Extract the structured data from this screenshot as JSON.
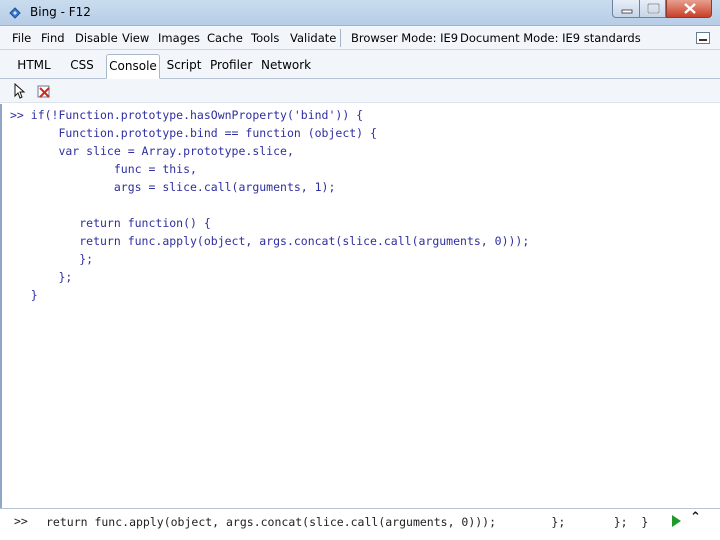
{
  "window": {
    "title": "Bing - F12"
  },
  "menubar": {
    "items": [
      "File",
      "Find",
      "Disable",
      "View",
      "Images",
      "Cache",
      "Tools",
      "Validate"
    ],
    "browser_mode": "Browser Mode: IE9",
    "document_mode": "Document Mode: IE9 standards"
  },
  "tabs": {
    "items": [
      "HTML",
      "CSS",
      "Console",
      "Script",
      "Profiler",
      "Network"
    ],
    "active": "Console"
  },
  "console": {
    "lines": [
      ">> if(!Function.prototype.hasOwnProperty('bind')) {",
      "       Function.prototype.bind == function (object) {",
      "       var slice = Array.prototype.slice,",
      "               func = this,",
      "               args = slice.call(arguments, 1);",
      "",
      "          return function() {",
      "          return func.apply(object, args.concat(slice.call(arguments, 0)));",
      "          };",
      "       };",
      "   }"
    ]
  },
  "command": {
    "prompt": ">>",
    "value": "return func.apply(object, args.concat(slice.call(arguments, 0)));        };       };  }"
  },
  "colors": {
    "code": "#2f2fa0",
    "run": "#1f9a2a",
    "title_gradient_top": "#c9dcef",
    "close_button": "#c7402a"
  },
  "icons": {
    "app": "ie-devtools-icon",
    "select_element": "arrow-cursor-icon",
    "clear_console": "clear-console-icon",
    "run": "play-icon",
    "expand": "double-chevron-up-icon"
  }
}
